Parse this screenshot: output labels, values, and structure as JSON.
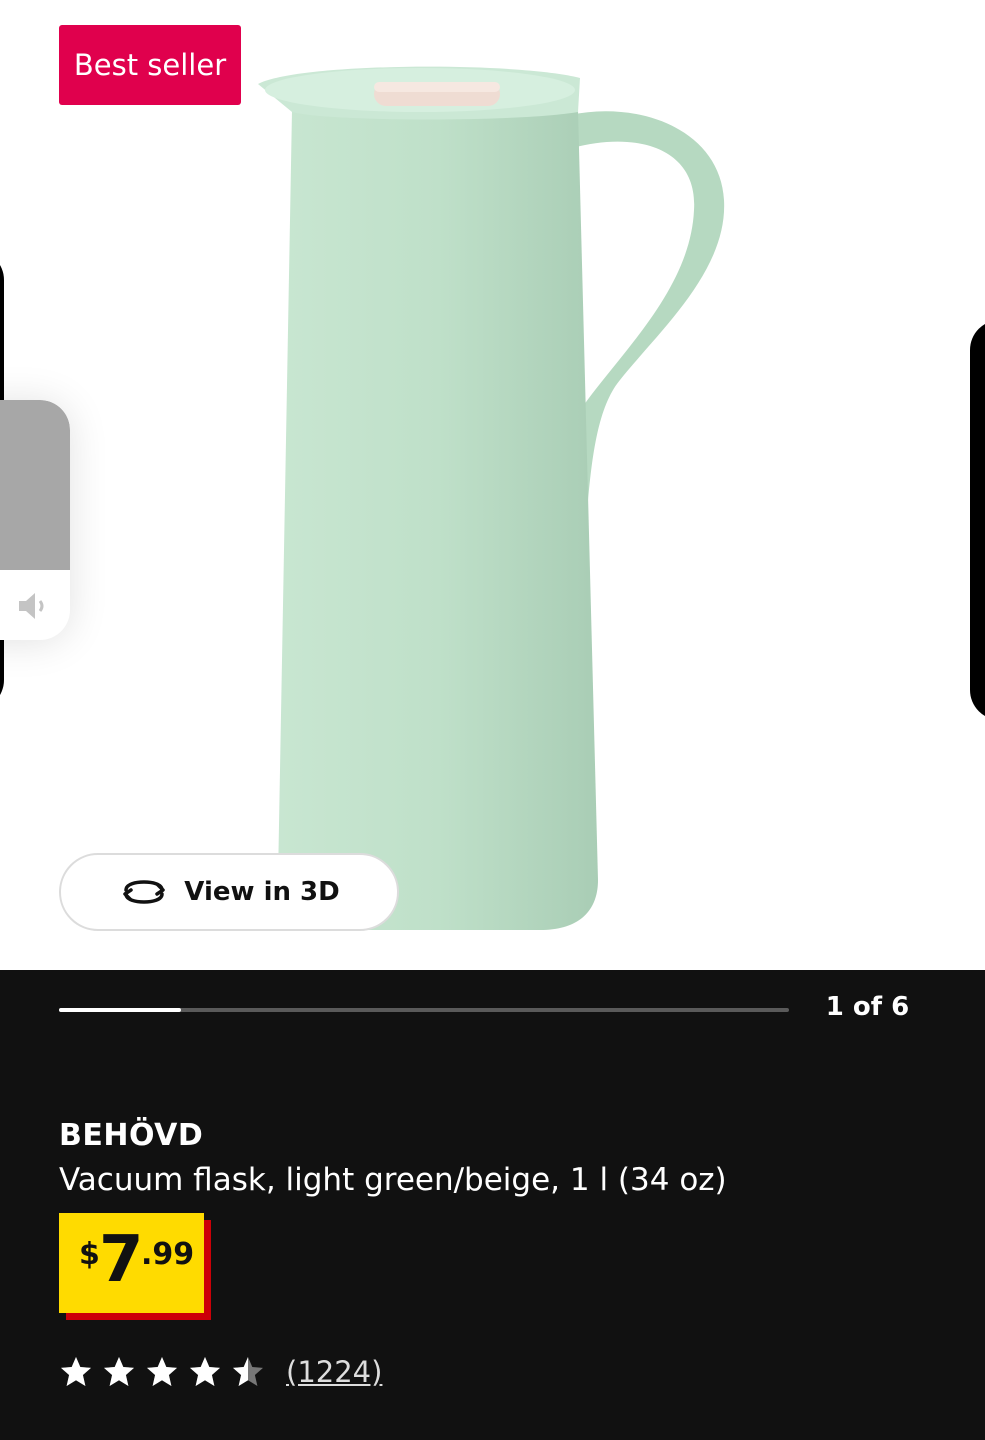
{
  "gallery": {
    "badge_label": "Best seller",
    "view3d_label": "View in 3D",
    "slide_current": 1,
    "slide_total": 6,
    "slide_counter": "1 of 6",
    "progress_fraction": 0.1667
  },
  "product": {
    "brand": "BEHÖVD",
    "description": "Vacuum flask, light green/beige, 1 l (34 oz)",
    "price": {
      "currency": "$",
      "integer": "7",
      "decimal": ".99"
    },
    "rating": {
      "value": 4.5,
      "max": 5,
      "count_label": "(1224)"
    }
  },
  "colors": {
    "badge": "#e0004d",
    "price_bg": "#ffdb00",
    "price_shadow": "#cc0008",
    "flask_body": "#bfe0c9",
    "flask_lid": "#efdcd3"
  }
}
